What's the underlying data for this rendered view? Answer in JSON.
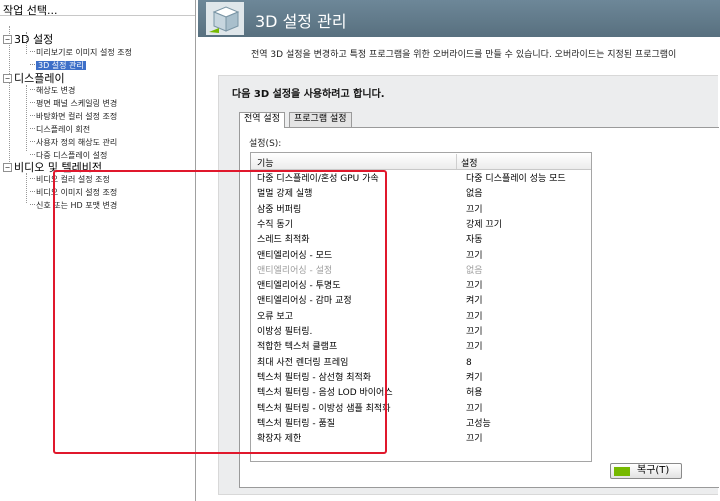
{
  "task_pane": {
    "title": "작업 선택...",
    "categories": [
      {
        "label": "3D 설정",
        "toggle": "−",
        "items": [
          "미리보기로 이미지 설정 조정",
          "3D 설정 관리"
        ]
      },
      {
        "label": "디스플레이",
        "toggle": "−",
        "items": [
          "해상도 변경",
          "평면 패널 스케일링 변경",
          "바탕화면 컬러 설정 조정",
          "디스플레이 회전",
          "사용자 정의 해상도 관리",
          "다중 디스플레이 설정"
        ]
      },
      {
        "label": "비디오 및 텔레비전",
        "toggle": "−",
        "items": [
          "비디오 컬러 설정 조정",
          "비디오 이미지 설정 조정",
          "신호 또는 HD 포맷 변경"
        ]
      }
    ],
    "selected_item": "3D 설정 관리"
  },
  "banner": {
    "title": "3D 설정 관리",
    "icon": "3d-cube-icon"
  },
  "description": "전역 3D 설정을 변경하고 특정 프로그램을 위한 오버라이드를 만들 수 있습니다. 오버라이드는 지정된 프로그램이",
  "panel": {
    "heading": "다음 3D 설정을 사용하려고 합니다.",
    "tabs": [
      "전역 설정",
      "프로그램 설정"
    ],
    "active_tab": "전역 설정",
    "settings_label": "설정(S):",
    "columns": {
      "feature": "기능",
      "setting": "설정"
    },
    "rows": [
      {
        "feature": "다중 디스플레이/혼성 GPU 가속",
        "value": "다중 디스플레이 성능 모드",
        "disabled": false
      },
      {
        "feature": "멀멀 강제 실행",
        "value": "없음",
        "disabled": false
      },
      {
        "feature": "삼중 버퍼링",
        "value": "끄기",
        "disabled": false
      },
      {
        "feature": "수직 동기",
        "value": "강제 끄기",
        "disabled": false
      },
      {
        "feature": "스레드 최적화",
        "value": "자동",
        "disabled": false
      },
      {
        "feature": "앤티엘리어싱 - 모드",
        "value": "끄기",
        "disabled": false
      },
      {
        "feature": "앤티엘리어싱 - 설정",
        "value": "없음",
        "disabled": true
      },
      {
        "feature": "앤티엘리어싱 - 투명도",
        "value": "끄기",
        "disabled": false
      },
      {
        "feature": "앤티엘리어싱 - 감마 교정",
        "value": "켜기",
        "disabled": false
      },
      {
        "feature": "오류 보고",
        "value": "끄기",
        "disabled": false
      },
      {
        "feature": "이방성 필터링.",
        "value": "끄기",
        "disabled": false
      },
      {
        "feature": "적합한 텍스처 클램프",
        "value": "끄기",
        "disabled": false
      },
      {
        "feature": "최대 사전 렌더링 프레임",
        "value": "8",
        "disabled": false
      },
      {
        "feature": "텍스처 필터링 - 삼선형 최적화",
        "value": "켜기",
        "disabled": false
      },
      {
        "feature": "텍스처 필터링 - 음성 LOD 바이어스",
        "value": "허용",
        "disabled": false
      },
      {
        "feature": "텍스처 필터링 - 이방성 샘플 최적화",
        "value": "끄기",
        "disabled": false
      },
      {
        "feature": "텍스처 필터링 - 품질",
        "value": "고성능",
        "disabled": false
      },
      {
        "feature": "확장자 제한",
        "value": "끄기",
        "disabled": false
      }
    ],
    "restore_button": "복구(T)"
  },
  "colors": {
    "banner": "#617c8c",
    "selection": "#3d6fc8",
    "highlight": "#e0182c",
    "nvidia": "#76b900"
  }
}
